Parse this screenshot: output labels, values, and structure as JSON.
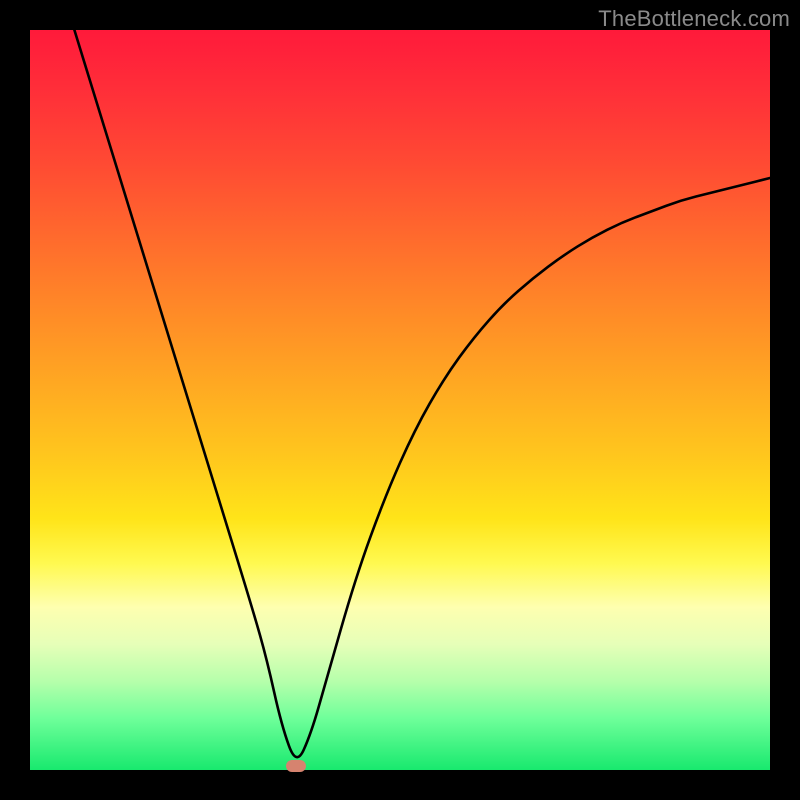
{
  "attribution": "TheBottleneck.com",
  "chart_data": {
    "type": "line",
    "title": "",
    "xlabel": "",
    "ylabel": "",
    "xlim": [
      0,
      100
    ],
    "ylim": [
      0,
      100
    ],
    "series": [
      {
        "name": "bottleneck-curve",
        "x": [
          6,
          10,
          14,
          18,
          22,
          26,
          30,
          32,
          34,
          36,
          38,
          40,
          44,
          48,
          52,
          56,
          60,
          64,
          68,
          72,
          76,
          80,
          84,
          88,
          92,
          96,
          100
        ],
        "values": [
          100,
          87,
          74,
          61,
          48,
          35,
          22,
          15,
          6,
          0.5,
          5,
          12,
          26,
          37,
          46,
          53,
          58.5,
          63,
          66.5,
          69.5,
          72,
          74,
          75.5,
          77,
          78,
          79,
          80
        ]
      }
    ],
    "annotations": [
      {
        "name": "min-marker",
        "x": 36,
        "y": 0.5
      }
    ],
    "background_gradient": {
      "top": "#ff1a3a",
      "mid": "#fff94f",
      "bottom": "#18e96e"
    }
  }
}
